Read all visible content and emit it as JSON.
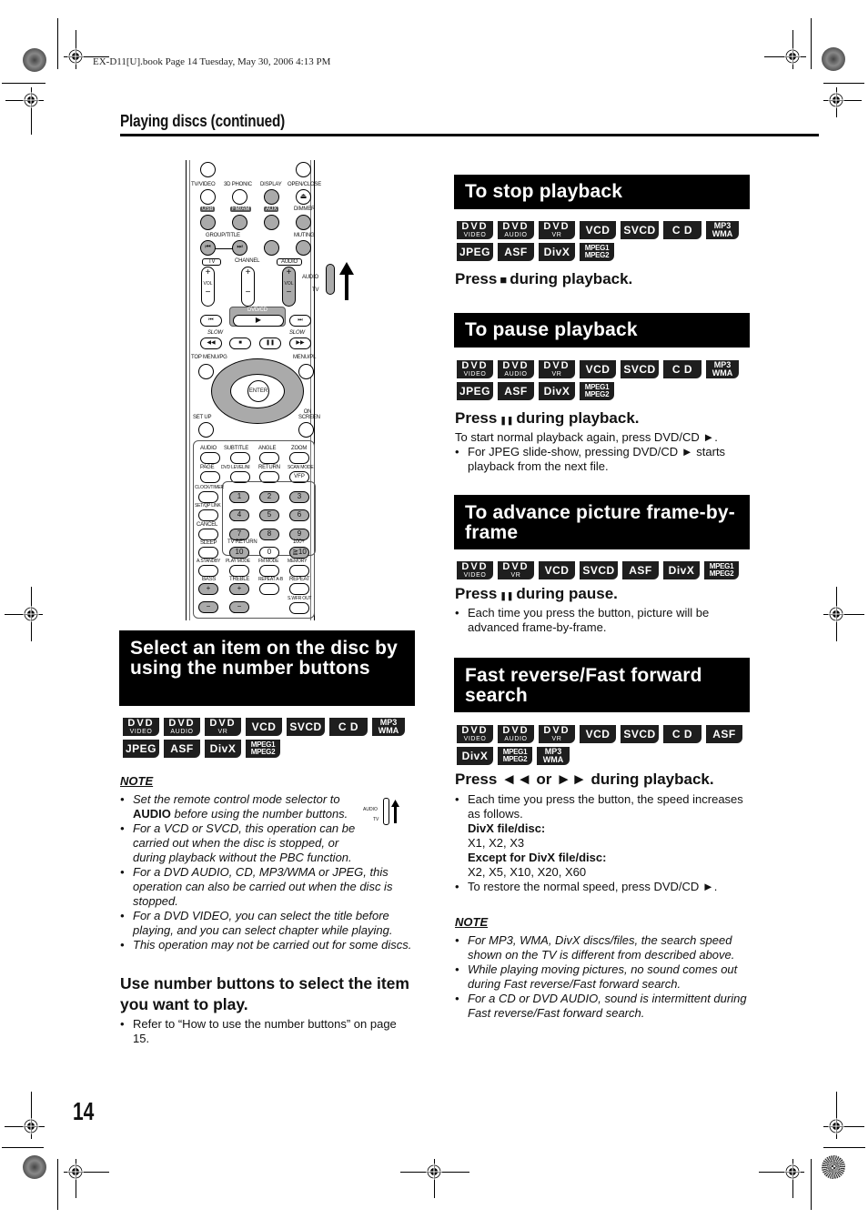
{
  "file_header": "EX-D11[U].book  Page 14  Tuesday, May 30, 2006  4:13 PM",
  "running_head": "Playing discs (continued)",
  "page_number": "14",
  "remote": {
    "labels": {
      "tv_video": "TV/VIDEO",
      "phonic": "3D PHONIC",
      "display": "DISPLAY",
      "open_close": "OPEN/CLOSE",
      "usb": "USB",
      "fm_am": "FM/AM",
      "aux": "AUX",
      "dimmer": "DIMMER",
      "group_title": "GROUP/TITLE",
      "muting": "MUTING",
      "tv": "TV",
      "channel": "CHANNEL",
      "audio": "AUDIO",
      "vol": "VOL",
      "switch_audio": "AUDIO",
      "switch_tv": "TV",
      "dvd_cd": "DVD/CD",
      "slow_left": "SLOW",
      "slow_right": "SLOW",
      "top_menu": "TOP MENU/PG",
      "menu_pl": "MENU/PL",
      "enter": "ENTER",
      "set_up": "SET UP",
      "on_screen": "ON SCREEN",
      "audio2": "AUDIO",
      "subtitle": "SUBTITLE",
      "angle": "ANGLE",
      "zoom": "ZOOM",
      "page": "PAGE",
      "dvd_level": "DVD LEVEL/NI",
      "return": "RETURN",
      "scan_mode": "SCAN MODE",
      "vfp": "VFP",
      "clock_timer": "CLOCK/TIMER",
      "set_link": "SET/QP LINK",
      "cancel": "CANCEL",
      "sleep": "SLEEP",
      "tv_return": "TV RETURN",
      "hundred_plus": "100+",
      "a_standby": "A.STANDBY",
      "play_mode": "PLAY MODE",
      "fm_mode": "FM MODE",
      "memory": "MEMORY",
      "bass": "BASS",
      "treble": "TREBLE",
      "repeat_ab": "REPEAT A-B",
      "repeat": "REPEAT",
      "swfr_out": "S.WFR OUT"
    },
    "numbers": [
      "1",
      "2",
      "3",
      "4",
      "5",
      "6",
      "7",
      "8",
      "9",
      "10",
      "0",
      "≧10"
    ]
  },
  "left_section": {
    "title": "Select an item on the disc by using the number buttons",
    "badges": [
      "DVD VIDEO",
      "DVD AUDIO",
      "DVD VR",
      "VCD",
      "SVCD",
      "CD",
      "MP3 WMA",
      "JPEG",
      "ASF",
      "DivX",
      "MPEG1 MPEG2"
    ],
    "note_title": "NOTE",
    "notes": [
      {
        "pre": "Set the remote control mode selector to ",
        "bold": "AUDIO",
        "post": " before using the number buttons."
      },
      {
        "text": "For a VCD or SVCD, this operation can be carried out when the disc is stopped, or during playback without the PBC function."
      },
      {
        "text": "For a DVD AUDIO, CD, MP3/WMA or JPEG, this operation can also be carried out when the disc is stopped."
      },
      {
        "text": "For a DVD VIDEO, you can select the title before playing, and you can select chapter while playing."
      },
      {
        "text": "This operation may not be carried out for some discs."
      }
    ],
    "note_switch": {
      "audio": "AUDIO",
      "tv": "TV"
    },
    "instruction": "Use number buttons to select the item you want to play.",
    "bullets": [
      "Refer to “How to use the number buttons” on page 15."
    ]
  },
  "stop_section": {
    "title": "To stop playback",
    "badges": [
      "DVD VIDEO",
      "DVD AUDIO",
      "DVD VR",
      "VCD",
      "SVCD",
      "CD",
      "MP3 WMA",
      "JPEG",
      "ASF",
      "DivX",
      "MPEG1 MPEG2"
    ],
    "press_pre": "Press",
    "press_symbol": "■",
    "press_post": "during playback."
  },
  "pause_section": {
    "title": "To pause playback",
    "badges": [
      "DVD VIDEO",
      "DVD AUDIO",
      "DVD VR",
      "VCD",
      "SVCD",
      "CD",
      "MP3 WMA",
      "JPEG",
      "ASF",
      "DivX",
      "MPEG1 MPEG2"
    ],
    "press_pre": "Press",
    "press_symbol": "❚❚",
    "press_post": "during playback.",
    "text": "To start normal playback again, press DVD/CD ►.",
    "bullets": [
      "For JPEG slide-show, pressing DVD/CD ► starts playback from the next file."
    ]
  },
  "frame_section": {
    "title": "To advance picture frame-by-frame",
    "badges": [
      "DVD VIDEO",
      "DVD VR",
      "VCD",
      "SVCD",
      "ASF",
      "DivX",
      "MPEG1 MPEG2"
    ],
    "press_pre": "Press",
    "press_symbol": "❚❚",
    "press_post": "during pause.",
    "bullets": [
      "Each time you press the button, picture will be advanced frame-by-frame."
    ]
  },
  "search_section": {
    "title": "Fast reverse/Fast forward search",
    "badges": [
      "DVD VIDEO",
      "DVD AUDIO",
      "DVD VR",
      "VCD",
      "SVCD",
      "CD",
      "ASF",
      "DivX",
      "MPEG1 MPEG2",
      "MP3 WMA"
    ],
    "press_text": "Press ◄◄ or ►► during playback.",
    "bullet1": "Each time you press the button, the speed increases as follows.",
    "divx_label": "DivX file/disc:",
    "divx_speeds": "X1, X2, X3",
    "except_label": "Except for DivX file/disc:",
    "except_speeds": "X2, X5, X10, X20, X60",
    "bullet2": "To restore the normal speed, press DVD/CD ►.",
    "note_title": "NOTE",
    "notes": [
      "For MP3, WMA, DivX discs/files, the search speed shown on the TV is different from described above.",
      "While playing moving pictures, no sound comes out during Fast reverse/Fast forward search.",
      "For a CD or DVD AUDIO, sound is intermittent during Fast reverse/Fast forward search."
    ]
  }
}
